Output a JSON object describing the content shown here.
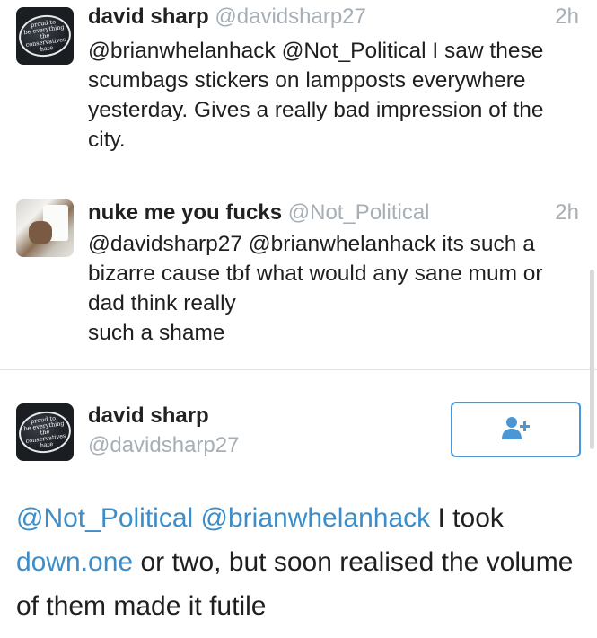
{
  "tweets": [
    {
      "avatar_badge_lines": [
        "proud to",
        "be everything",
        "the",
        "conservatives",
        "hate"
      ],
      "name": "david sharp",
      "handle": "@davidsharp27",
      "time": "2h",
      "mentions": [
        "@brianwhelanhack",
        "@Not_Political"
      ],
      "text": "I saw these scumbags stickers on lampposts everywhere yesterday. Gives a really bad impression of the city."
    },
    {
      "name": "nuke me you fucks",
      "handle": "@Not_Political",
      "time": "2h",
      "mentions": [
        "@davidsharp27",
        "@brianwhelanhack"
      ],
      "text_line1": "its such a bizarre cause tbf what would any sane mum or dad think really",
      "text_line2": "such a shame"
    }
  ],
  "detail": {
    "avatar_badge_lines": [
      "proud to",
      "be everything",
      "the",
      "conservatives",
      "hate"
    ],
    "name": "david sharp",
    "handle": "@davidsharp27",
    "follow_icon": "add-user-icon",
    "mention1": "@Not_Political",
    "mention2": "@brianwhelanhack",
    "text_part1": "I took",
    "link_text": "down.one",
    "text_part2": "or two, but soon realised the volume of them made it futile"
  },
  "colors": {
    "link": "#3d8dc8",
    "meta": "#a6aeb6",
    "follow_border": "#4b97d6"
  }
}
